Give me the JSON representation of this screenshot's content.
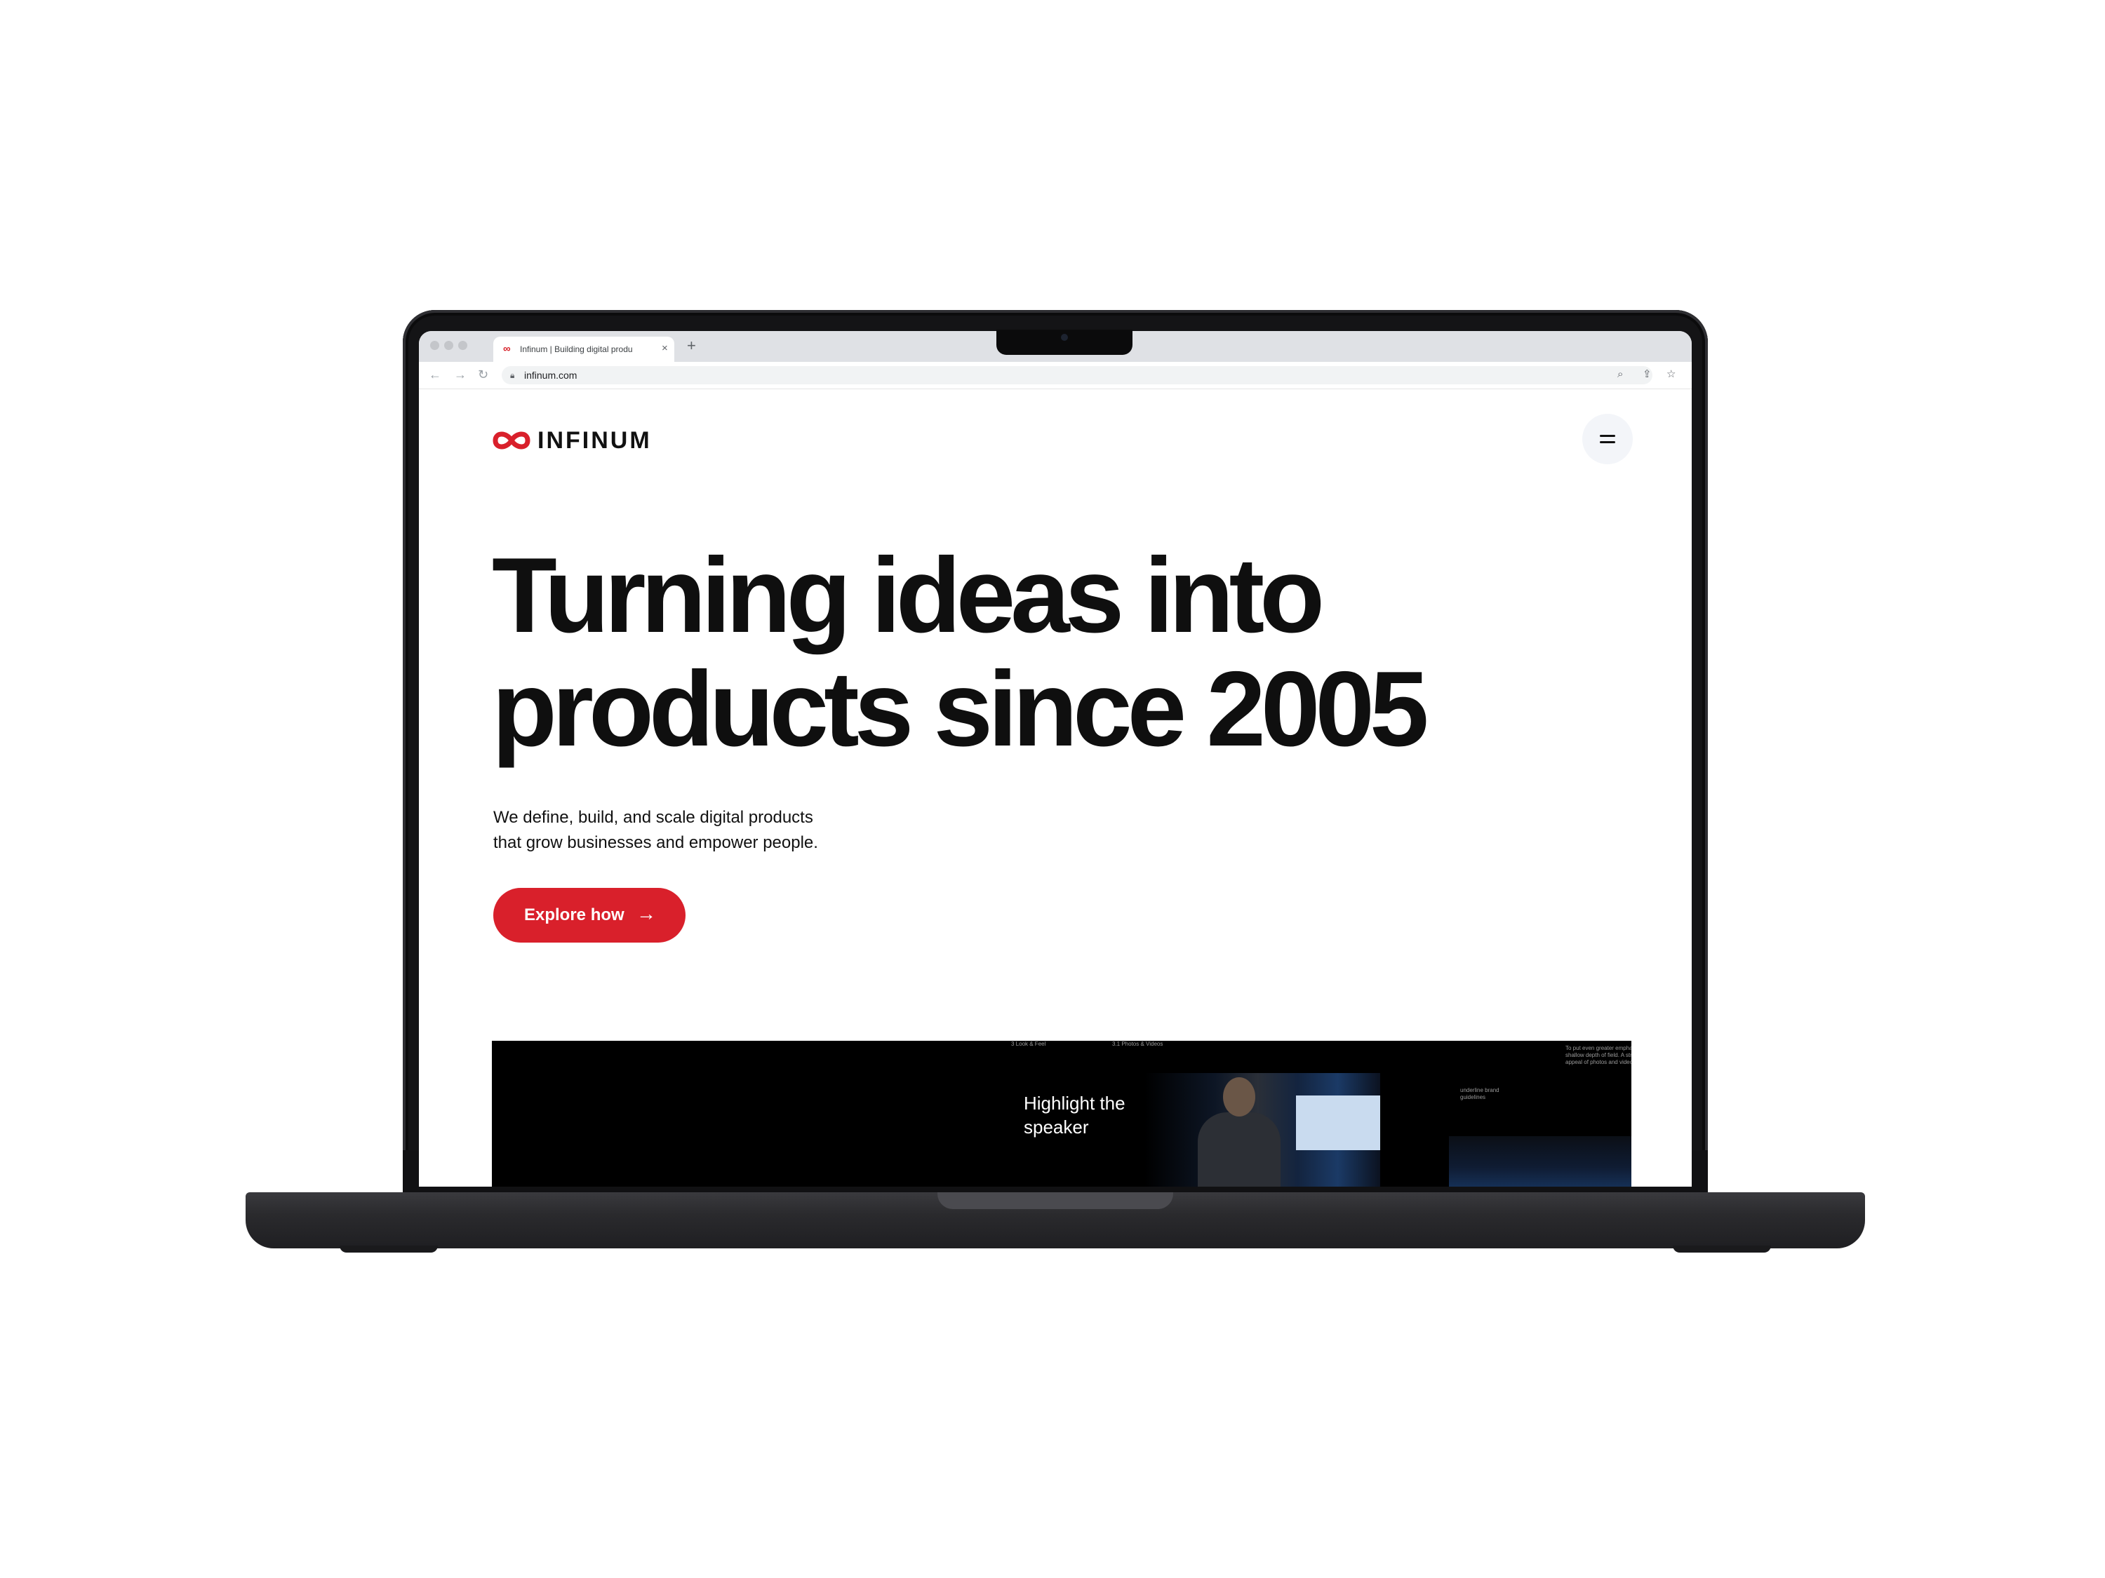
{
  "browser": {
    "tab_title": "Infinum | Building digital produ",
    "tab_favicon": "∞",
    "tab_close": "×",
    "new_tab": "+",
    "url": "infinum.com",
    "icons": [
      "back-arrow-icon",
      "forward-arrow-icon",
      "reload-icon",
      "lock-icon",
      "zoom-icon",
      "share-icon",
      "bookmark-star-icon"
    ]
  },
  "header": {
    "logo_text": "INFINUM",
    "menu_icon": "hamburger-menu-icon"
  },
  "hero": {
    "title_line1": "Turning ideas into",
    "title_line2": "products since 2005",
    "subtitle_line1": "We define, build, and scale digital products",
    "subtitle_line2": "that grow businesses and empower people.",
    "cta_label": "Explore how",
    "cta_icon": "arrow-right-icon"
  },
  "showcase": {
    "small_label_1": "3 Look & Feel",
    "small_label_2": "3.1 Photos & Videos",
    "corner_note_line1": "To put even greater emphasis on",
    "corner_note_line2": "shallow depth of field. A stronger",
    "corner_note_line3": "appeal of photos and videos.",
    "heading": "Highlight the speaker",
    "brand_note_line1": "underline brand",
    "brand_note_line2": "guidelines"
  },
  "colors": {
    "brand_red": "#d9202b",
    "text_dark": "#0f0f0f",
    "menu_bg": "#f3f5f9",
    "laptop_body": "#141416"
  }
}
